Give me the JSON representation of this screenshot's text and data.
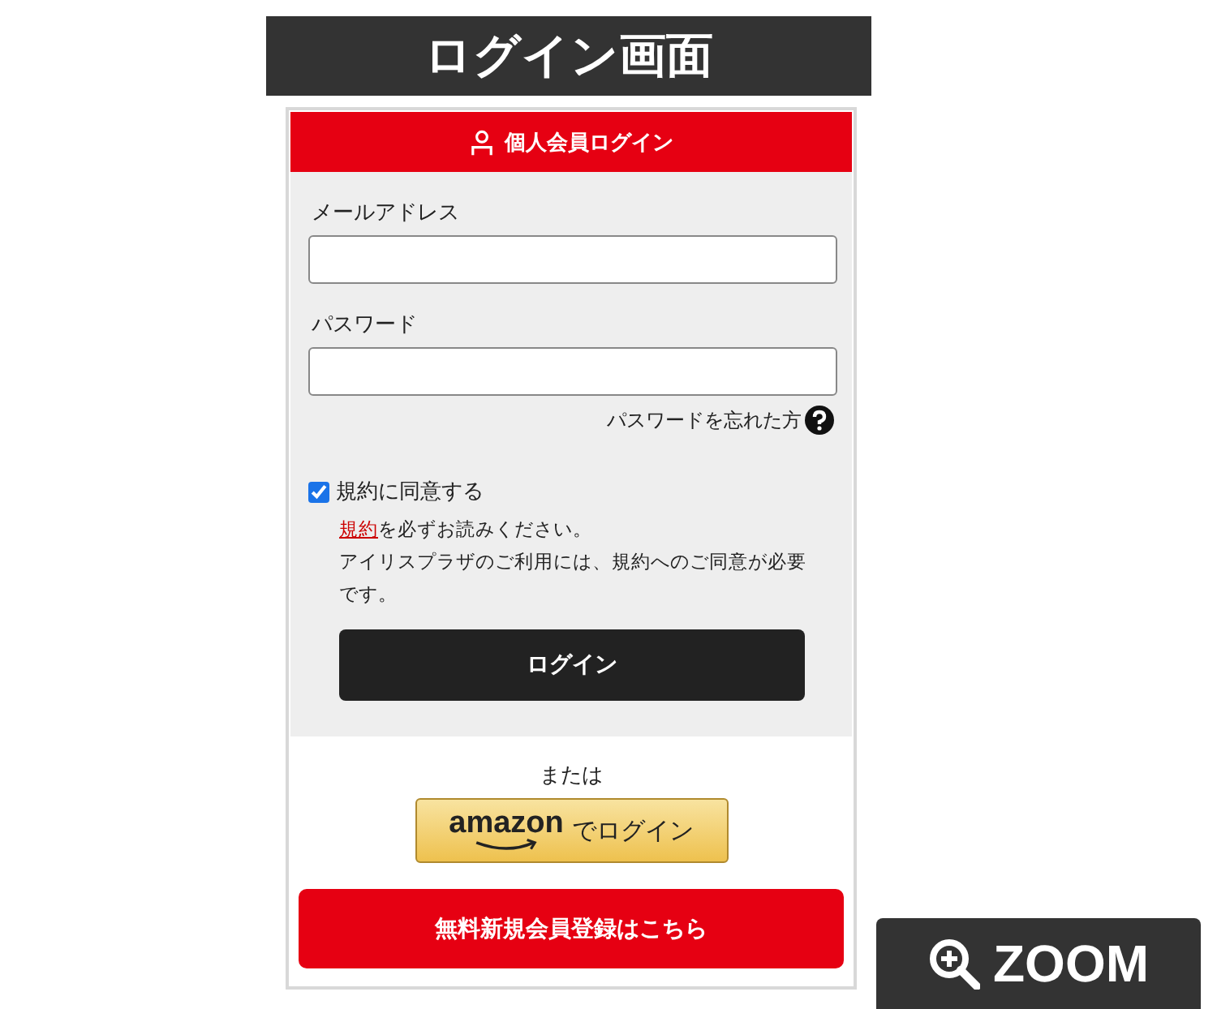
{
  "banner": {
    "title": "ログイン画面"
  },
  "header": {
    "title": "個人会員ログイン"
  },
  "fields": [
    {
      "label": "メールアドレス"
    },
    {
      "label": "パスワード"
    }
  ],
  "forgot_link": "パスワードを忘れた方",
  "agree": {
    "label": "規約に同意する",
    "checked": true
  },
  "terms_note": {
    "link": "規約",
    "text": "を必ずお読みください。"
  },
  "terms_detail": "アイリスプラザのご利用には、規約へのご同意が必要です。",
  "login_button": "ログイン",
  "or_text": "または",
  "amazon_button": {
    "brand": "amazon",
    "text": "でログイン"
  },
  "register_button": "無料新規会員登録はこちら",
  "zoom_badge": "ZOOM"
}
